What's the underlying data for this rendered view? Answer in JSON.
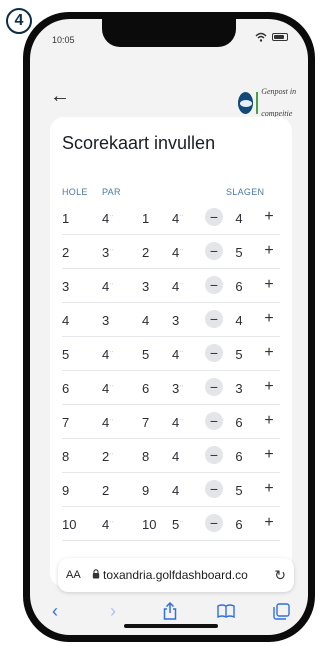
{
  "step_badge": "4",
  "status": {
    "time": "10:05"
  },
  "header": {
    "logo_text": "Genpost in compeitie"
  },
  "card": {
    "title": "Scorekaart invullen",
    "columns": {
      "hole": "HOLE",
      "par": "PAR",
      "strokes": "SLAGEN"
    }
  },
  "rows": [
    {
      "hole": "1",
      "par": "4",
      "par_mark": "··",
      "hole2": "1",
      "par2": "4",
      "par2_mark": "··",
      "strokes": "4"
    },
    {
      "hole": "2",
      "par": "3",
      "par_mark": "··",
      "hole2": "2",
      "par2": "4",
      "par2_mark": "··",
      "strokes": "5"
    },
    {
      "hole": "3",
      "par": "4",
      "par_mark": "··",
      "hole2": "3",
      "par2": "4",
      "par2_mark": "··",
      "strokes": "6"
    },
    {
      "hole": "4",
      "par": "3",
      "par_mark": "",
      "hole2": "4",
      "par2": "3",
      "par2_mark": "",
      "strokes": "4"
    },
    {
      "hole": "5",
      "par": "4",
      "par_mark": "··",
      "hole2": "5",
      "par2": "4",
      "par2_mark": "··",
      "strokes": "5"
    },
    {
      "hole": "6",
      "par": "4",
      "par_mark": "··",
      "hole2": "6",
      "par2": "3",
      "par2_mark": "··",
      "strokes": "3"
    },
    {
      "hole": "7",
      "par": "4",
      "par_mark": "··",
      "hole2": "7",
      "par2": "4",
      "par2_mark": "··",
      "strokes": "6"
    },
    {
      "hole": "8",
      "par": "2",
      "par_mark": "··",
      "hole2": "8",
      "par2": "4",
      "par2_mark": "",
      "strokes": "6"
    },
    {
      "hole": "9",
      "par": "2",
      "par_mark": "",
      "hole2": "9",
      "par2": "4",
      "par2_mark": "",
      "strokes": "5"
    },
    {
      "hole": "10",
      "par": "4",
      "par_mark": "··",
      "hole2": "10",
      "par2": "5",
      "par2_mark": "··",
      "strokes": "6"
    }
  ],
  "browser": {
    "aa_label": "AA",
    "url": "toxandria.golfdashboard.co"
  },
  "icons": {
    "back": "left-arrow-icon",
    "reload": "reload-icon",
    "toolbar": [
      "back-icon",
      "forward-icon",
      "share-icon",
      "bookmarks-icon",
      "tabs-icon"
    ]
  },
  "colors": {
    "accent": "#2f6fe0",
    "header_label": "#4a78a5",
    "logo_blue": "#12497a",
    "logo_green": "#4aa049"
  }
}
